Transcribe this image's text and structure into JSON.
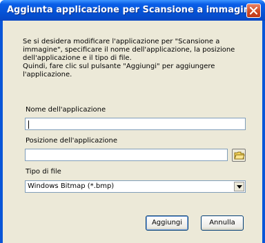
{
  "window": {
    "title": "Aggiunta applicazione per Scansione a immagine"
  },
  "instructions": {
    "lines": [
      "Se si desidera modificare l'applicazione per \"Scansione a",
      "immagine\", specificare il nome dell'applicazione, la posizione",
      "dell'applicazione e il tipo di file.",
      "Quindi, fare clic sul pulsante \"Aggiungi\" per aggiungere",
      "l'applicazione."
    ]
  },
  "form": {
    "app_name_label": "Nome dell'applicazione",
    "app_name_value": "",
    "app_location_label": "Posizione dell'applicazione",
    "app_location_value": "",
    "file_type_label": "Tipo di file",
    "file_type_value": "Windows Bitmap (*.bmp)"
  },
  "buttons": {
    "add": "Aggiungi",
    "cancel": "Annulla"
  },
  "icons": {
    "close": "close-icon",
    "browse": "folder-icon",
    "dropdown": "chevron-down-icon"
  }
}
